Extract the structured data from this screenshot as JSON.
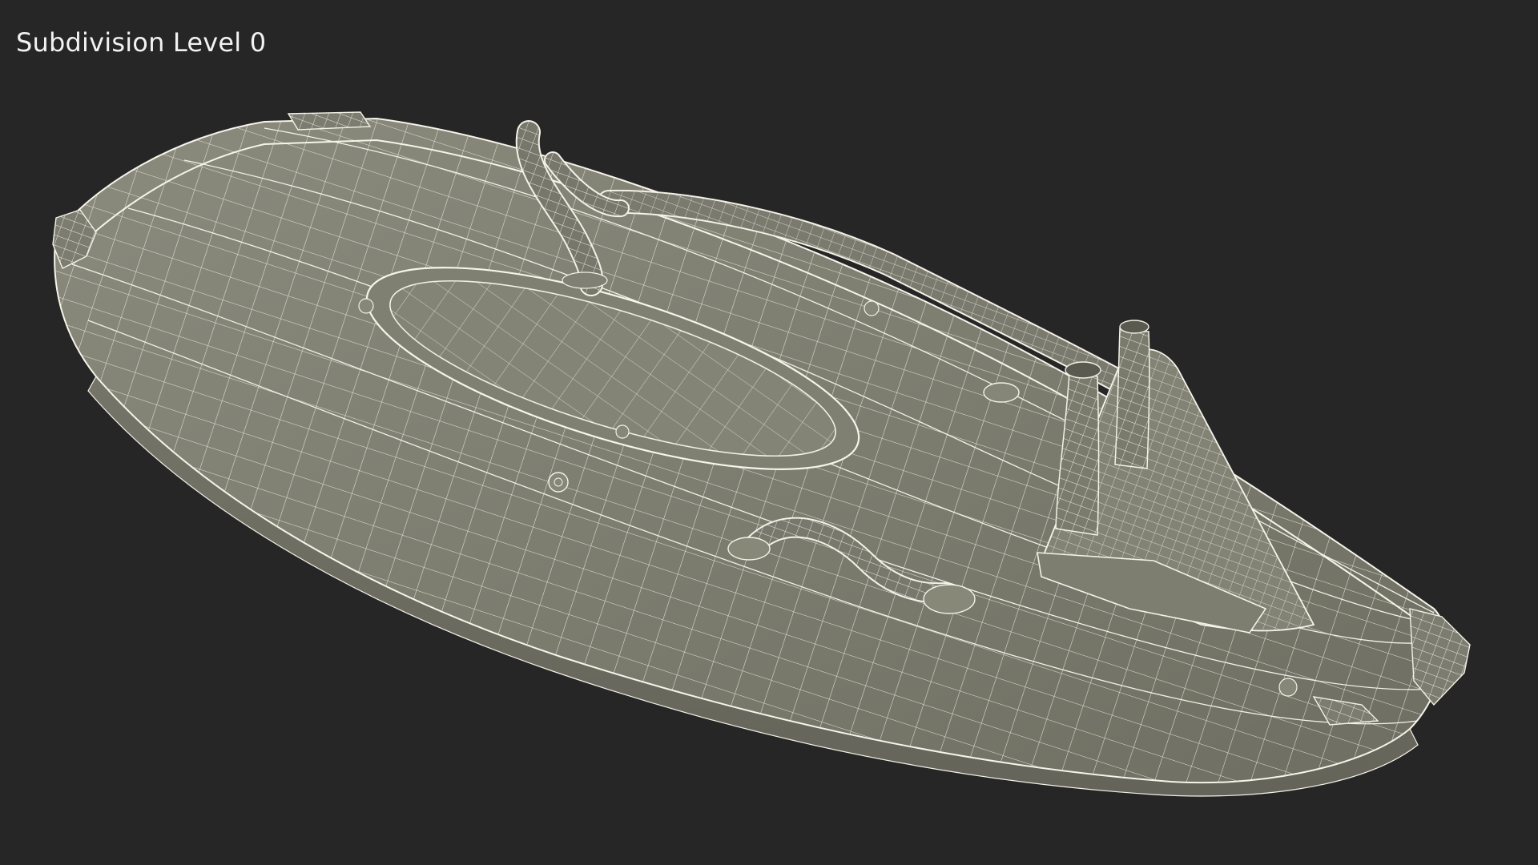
{
  "viewport": {
    "label": "Subdivision Level 0",
    "background_color": "#262626",
    "surface_color": "#7b7b6e",
    "wire_color": "#f4f1e6"
  }
}
